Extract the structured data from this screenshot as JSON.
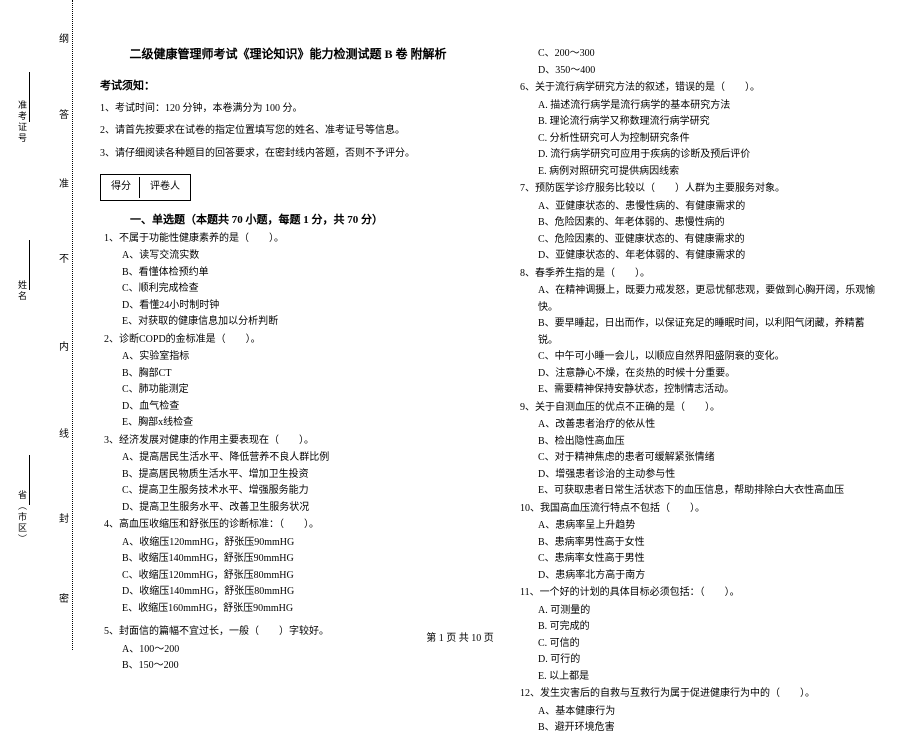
{
  "binding": {
    "province": "省（市区）",
    "name": "姓名",
    "examno": "准考证号",
    "chars": [
      "纲",
      "答",
      "准",
      "不",
      "内",
      "线",
      "封",
      "密"
    ]
  },
  "title": "二级健康管理师考试《理论知识》能力检测试题 B 卷 附解析",
  "notice_header": "考试须知：",
  "notices": [
    "1、考试时间：120 分钟，本卷满分为 100 分。",
    "2、请首先按要求在试卷的指定位置填写您的姓名、准考证号等信息。",
    "3、请仔细阅读各种题目的回答要求，在密封线内答题，否则不予评分。"
  ],
  "scorebox": {
    "score": "得分",
    "judge": "评卷人"
  },
  "section1": "一、单选题（本题共 70 小题，每题 1 分，共 70 分）",
  "col1": {
    "q1": "1、不属于功能性健康素养的是（　　）。",
    "q1o": [
      "A、读写交流实数",
      "B、看懂体检预约单",
      "C、顺利完成检查",
      "D、看懂24小时制时钟",
      "E、对获取的健康信息加以分析判断"
    ],
    "q2": "2、诊断COPD的金标准是（　　）。",
    "q2o": [
      "A、实验室指标",
      "B、胸部CT",
      "C、肺功能测定",
      "D、血气检查",
      "E、胸部x线检查"
    ],
    "q3": "3、经济发展对健康的作用主要表现在（　　）。",
    "q3o": [
      "A、提高居民生活水平、降低营养不良人群比例",
      "B、提高居民物质生活水平、增加卫生投资",
      "C、提高卫生服务技术水平、增强服务能力",
      "D、提高卫生服务水平、改善卫生服务状况"
    ],
    "q4": "4、高血压收缩压和舒张压的诊断标准：（　　）。",
    "q4o": [
      "A、收缩压120mmHG，舒张压90mmHG",
      "B、收缩压140mmHG，舒张压90mmHG",
      "C、收缩压120mmHG，舒张压80mmHG",
      "D、收缩压140mmHG，舒张压80mmHG",
      "E、收缩压160mmHG，舒张压90mmHG"
    ],
    "q5": "5、封面信的篇幅不宜过长，一般（　　）字较好。",
    "q5o": [
      "A、100～200",
      "B、150～200"
    ]
  },
  "col2": {
    "q5o2": [
      "C、200～300",
      "D、350～400"
    ],
    "q6": "6、关于流行病学研究方法的叙述，错误的是（　　）。",
    "q6o": [
      "A. 描述流行病学是流行病学的基本研究方法",
      "B. 理论流行病学又称数理流行病学研究",
      "C. 分析性研究可人为控制研究条件",
      "D. 流行病学研究可应用于疾病的诊断及预后评价",
      "E. 病例对照研究可提供病因线索"
    ],
    "q7": "7、预防医学诊疗服务比较以（　　）人群为主要服务对象。",
    "q7o": [
      "A、亚健康状态的、患慢性病的、有健康需求的",
      "B、危险因素的、年老体弱的、患慢性病的",
      "C、危险因素的、亚健康状态的、有健康需求的",
      "D、亚健康状态的、年老体弱的、有健康需求的"
    ],
    "q8": "8、春季养生指的是（　　）。",
    "q8o": [
      "A、在精神调摄上，既要力戒发怒，更忌忧郁悲观，要做到心胸开阔，乐观愉快。",
      "B、要早睡起，日出而作，以保证充足的睡眠时间，以利阳气闭藏，养精蓄锐。",
      "C、中午可小睡一会儿，以顺应自然界阳盛阴衰的变化。",
      "D、注意静心不燥，在炎热的时候十分重要。",
      "E、需要精神保持安静状态，控制情志活动。"
    ],
    "q9": "9、关于自测血压的优点不正确的是（　　）。",
    "q9o": [
      "A、改善患者治疗的依从性",
      "B、检出隐性高血压",
      "C、对于精神焦虑的患者可缓解紧张情绪",
      "D、增强患者诊治的主动参与性",
      "E、可获取患者日常生活状态下的血压信息，帮助排除白大衣性高血压"
    ],
    "q10": "10、我国高血压流行特点不包括（　　）。",
    "q10o": [
      "A、患病率呈上升趋势",
      "B、患病率男性高于女性",
      "C、患病率女性高于男性",
      "D、患病率北方高于南方"
    ],
    "q11": "11、一个好的计划的具体目标必须包括：（　　）。",
    "q11o": [
      "A. 可测量的",
      "B. 可完成的",
      "C. 可信的",
      "D. 可行的",
      "E. 以上都是"
    ],
    "q12": "12、发生灾害后的自救与互救行为属于促进健康行为中的（　　）。",
    "q12o": [
      "A、基本健康行为",
      "B、避开环境危害"
    ]
  },
  "footer": "第 1 页 共 10 页"
}
